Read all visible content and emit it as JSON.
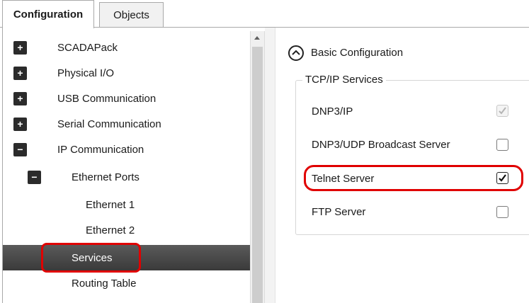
{
  "tabs": [
    {
      "label": "Configuration",
      "active": true
    },
    {
      "label": "Objects",
      "active": false
    }
  ],
  "tree": {
    "items": [
      {
        "label": "SCADAPack",
        "expander": "+"
      },
      {
        "label": "Physical I/O",
        "expander": "+"
      },
      {
        "label": "USB Communication",
        "expander": "+"
      },
      {
        "label": "Serial Communication",
        "expander": "+"
      },
      {
        "label": "IP Communication",
        "expander": "−"
      },
      {
        "label": "Ethernet Ports",
        "expander": "−"
      },
      {
        "label": "Ethernet 1"
      },
      {
        "label": "Ethernet 2"
      },
      {
        "label": "Services",
        "selected": true
      },
      {
        "label": "Routing Table"
      }
    ]
  },
  "panel": {
    "section_title": "Basic Configuration",
    "group_title": "TCP/IP Services",
    "services": [
      {
        "label": "DNP3/IP",
        "checked": true,
        "disabled": true
      },
      {
        "label": "DNP3/UDP Broadcast Server",
        "checked": false,
        "disabled": false
      },
      {
        "label": "Telnet Server",
        "checked": true,
        "disabled": false
      },
      {
        "label": "FTP Server",
        "checked": false,
        "disabled": false
      }
    ]
  },
  "colors": {
    "selection": "#464646",
    "highlight": "#e00000"
  }
}
